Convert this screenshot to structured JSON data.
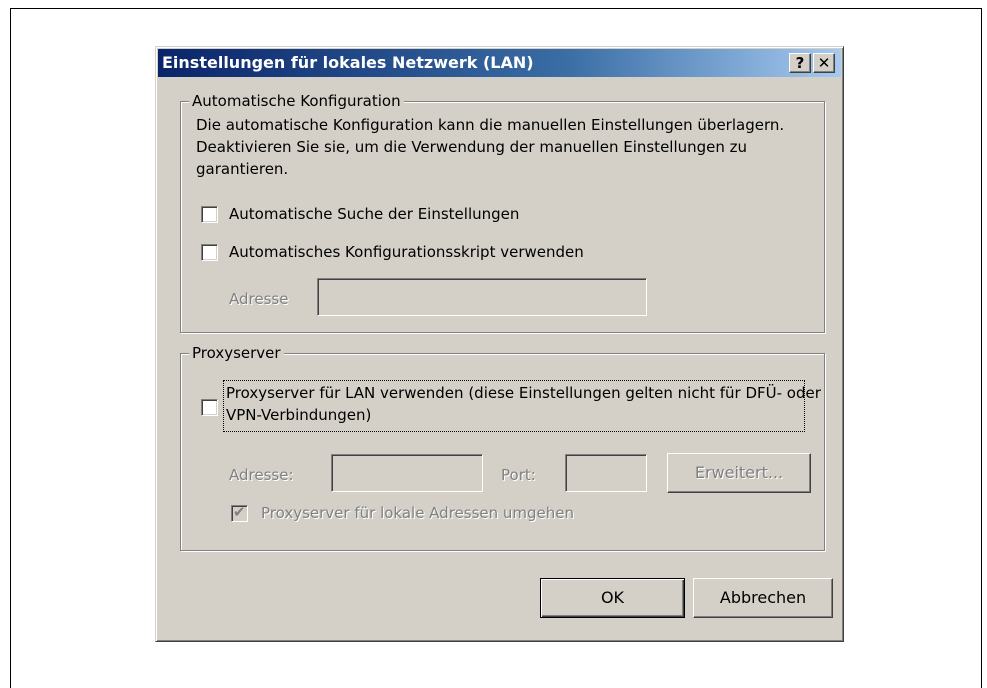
{
  "dialog": {
    "title": "Einstellungen für lokales Netzwerk (LAN)",
    "help_button": "?",
    "close_button": "✕"
  },
  "auto_config": {
    "legend": "Automatische Konfiguration",
    "description": "Die automatische Konfiguration kann die manuellen Einstellungen überlagern. Deaktivieren Sie sie, um die Verwendung der manuellen Einstellungen zu garantieren.",
    "auto_detect_label": "Automatische Suche der Einstellungen",
    "auto_detect_checked": false,
    "script_label": "Automatisches Konfigurationsskript verwenden",
    "script_checked": false,
    "address_label": "Adresse",
    "address_value": ""
  },
  "proxy": {
    "legend": "Proxyserver",
    "use_proxy_label": "Proxyserver für LAN verwenden (diese Einstellungen gelten nicht für DFÜ- oder VPN-Verbindungen)",
    "use_proxy_checked": false,
    "address_label": "Adresse:",
    "address_value": "",
    "port_label": "Port:",
    "port_value": "",
    "advanced_button": "Erweitert...",
    "bypass_label": "Proxyserver für lokale Adressen umgehen",
    "bypass_checked": true
  },
  "footer": {
    "ok_button": "OK",
    "cancel_button": "Abbrechen"
  }
}
